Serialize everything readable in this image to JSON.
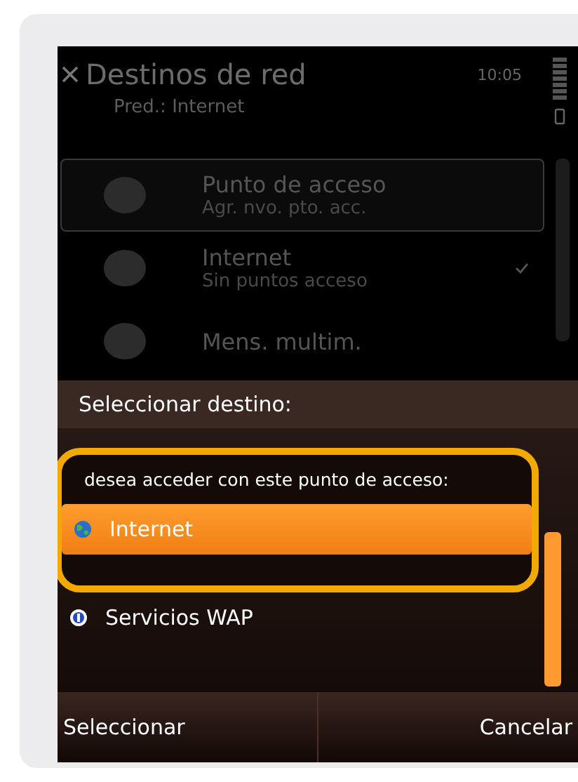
{
  "screen": {
    "title": "Destinos de red",
    "time": "10:05",
    "subtitle": "Pred.: Internet",
    "list": [
      {
        "title": "Punto de acceso",
        "detail": "Agr. nvo. pto. acc.",
        "selected": true,
        "checked": false
      },
      {
        "title": "Internet",
        "detail": "Sin puntos acceso",
        "selected": false,
        "checked": true
      },
      {
        "title": "Mens. multim.",
        "selected": false,
        "checked": false
      }
    ]
  },
  "dialog": {
    "title": "Seleccionar destino:",
    "message": "desea acceder con este punto de acceso:",
    "options": [
      {
        "label": "Internet",
        "selected": true,
        "kind": "globe"
      },
      {
        "label": "Servicios WAP",
        "selected": false,
        "kind": "info"
      }
    ]
  },
  "softkeys": {
    "left": "Seleccionar",
    "right": "Cancelar"
  }
}
